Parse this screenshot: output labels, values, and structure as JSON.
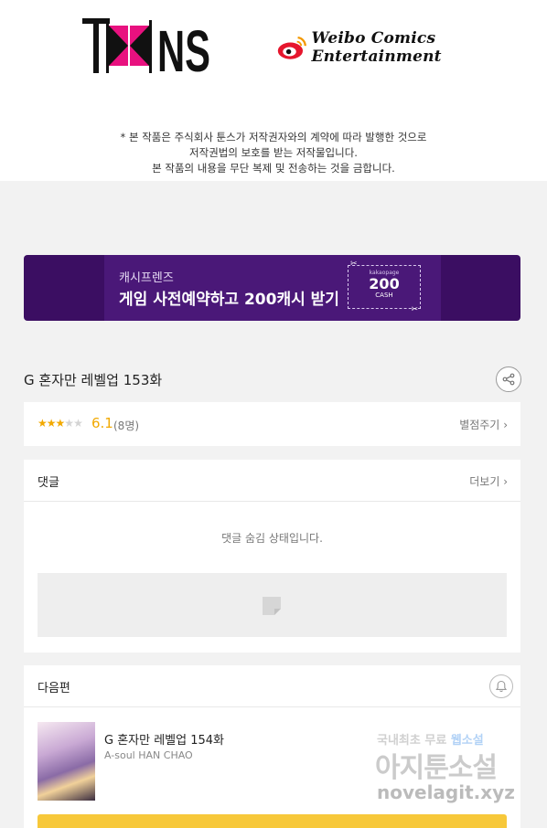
{
  "header": {
    "notice_lines": [
      "* 본 작품은 주식회사 툰스가 저작권자와의 계약에 따라 발행한 것으로",
      "저작권법의 보호를 받는 저작물입니다.",
      "본 작품의 내용을 무단 복제 및 전송하는 것을 금합니다."
    ]
  },
  "banner": {
    "subtitle": "캐시프렌즈",
    "title": "게임 사전예약하고 200캐시 받기",
    "coupon_brand": "kakaopage",
    "coupon_amount": "200",
    "coupon_unit": "CASH"
  },
  "episode": {
    "title": "G 혼자만 레벨업 153화"
  },
  "rating": {
    "score": "6.1",
    "count": "(8명)",
    "stars_filled": 3,
    "stars_total": 5,
    "rate_link": "별점주기"
  },
  "comments": {
    "title": "댓글",
    "more_link": "더보기",
    "hidden_message": "댓글 숨김 상태입니다."
  },
  "next_episode": {
    "section_title": "다음편",
    "title": "G 혼자만 레벨업 154화",
    "author": "A-soul HAN CHAO"
  },
  "watermark": {
    "line1_a": "국내최초 무료 ",
    "line1_b": "웹소설",
    "line2": "아지툰소설",
    "line3": "novelagit.xyz"
  },
  "colors": {
    "banner_bg": "#3b0e62",
    "accent_star": "#f2a900",
    "cta_button": "#f7c83a"
  }
}
